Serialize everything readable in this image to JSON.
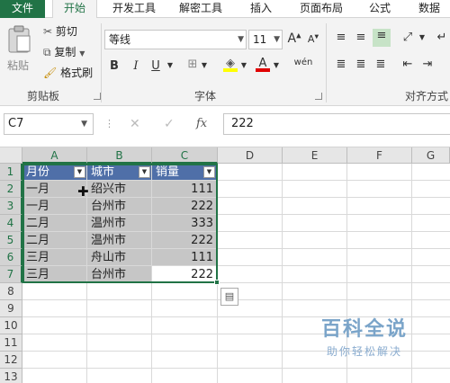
{
  "tabs": [
    "文件",
    "开始",
    "开发工具",
    "解密工具",
    "插入",
    "页面布局",
    "公式",
    "数据"
  ],
  "active_tab": "开始",
  "clipboard": {
    "paste_label": "粘贴",
    "cut_label": "剪切",
    "copy_label": "复制",
    "format_painter_label": "格式刷",
    "group_label": "剪贴板"
  },
  "font": {
    "name": "等线",
    "size": "11",
    "bold": "B",
    "italic": "I",
    "underline": "U",
    "wen": "wén",
    "grow": "A",
    "shrink": "A",
    "color_a": "A",
    "group_label": "字体"
  },
  "alignment": {
    "group_label": "对齐方式"
  },
  "formula_bar": {
    "name_box": "C7",
    "fx": "fx",
    "value": "222"
  },
  "columns": [
    "A",
    "B",
    "C",
    "D",
    "E",
    "F",
    "G"
  ],
  "rows": [
    "1",
    "2",
    "3",
    "4",
    "5",
    "6",
    "7",
    "8",
    "9",
    "10",
    "11",
    "12",
    "13"
  ],
  "table": {
    "headers": [
      "月份",
      "城市",
      "销量"
    ],
    "rows": [
      [
        "一月",
        "绍兴市",
        "111"
      ],
      [
        "一月",
        "台州市",
        "222"
      ],
      [
        "二月",
        "温州市",
        "333"
      ],
      [
        "二月",
        "温州市",
        "222"
      ],
      [
        "三月",
        "舟山市",
        "111"
      ],
      [
        "三月",
        "台州市",
        "222"
      ]
    ]
  },
  "watermark": {
    "title": "百科全说",
    "subtitle": "助你轻松解决"
  },
  "colors": {
    "excel_green": "#217346",
    "header_blue": "#4f6fa8",
    "selection_gray": "#c6c6c6"
  }
}
